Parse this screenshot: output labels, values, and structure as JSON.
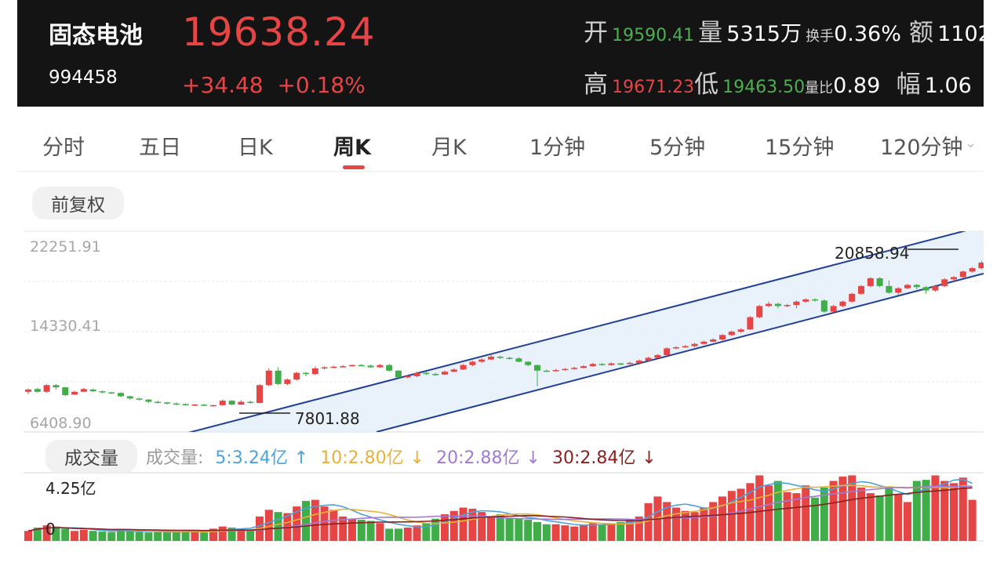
{
  "header": {
    "name": "固态电池",
    "code": "994458",
    "price": "19638.24",
    "change": "+34.48",
    "change_pct": "+0.18%",
    "open_label": "开",
    "open": "19590.41",
    "volume_label": "量",
    "volume": "5315万",
    "turnover_label": "换手",
    "turnover": "0.36%",
    "amount_label": "额",
    "amount": "1102",
    "high_label": "高",
    "high": "19671.23",
    "low_label": "低",
    "low": "19463.50",
    "vol_ratio_label": "量比",
    "vol_ratio": "0.89",
    "amplitude_label": "幅",
    "amplitude": "1.06"
  },
  "tabs": [
    {
      "label": "分时"
    },
    {
      "label": "五日"
    },
    {
      "label": "日K"
    },
    {
      "label": "周K",
      "active": true
    },
    {
      "label": "月K"
    },
    {
      "label": "1分钟"
    },
    {
      "label": "5分钟"
    },
    {
      "label": "15分钟"
    },
    {
      "label": "120分钟"
    }
  ],
  "adjust_label": "前复权",
  "volume_panel": {
    "label": "成交量",
    "ma_label": "成交量:",
    "ma5": "5:3.24亿",
    "ma10": "10:2.80亿",
    "ma20": "20:2.88亿",
    "ma30": "30:2.84亿",
    "max_label": "4.25亿",
    "zero_label": "0"
  },
  "chart_data": {
    "type": "candlestick",
    "y_axis_labels": [
      "22251.91",
      "14330.41",
      "6408.90"
    ],
    "ylim": [
      6408.9,
      22251.91
    ],
    "annotations": {
      "low": "7801.88",
      "high": "20858.94"
    },
    "colors": {
      "up": "#e54545",
      "down": "#3fae49",
      "channel": "#1f3f9a",
      "ma5": "#4aa3df",
      "ma10": "#e8b23a",
      "ma20": "#a27ad6",
      "ma30": "#8b2020"
    },
    "candles": [
      [
        9100,
        9300,
        9400,
        8900
      ],
      [
        9350,
        9100,
        9450,
        9000
      ],
      [
        9100,
        9700,
        9800,
        9000
      ],
      [
        9700,
        9500,
        9800,
        9300
      ],
      [
        9500,
        8800,
        9550,
        8700
      ],
      [
        8850,
        9100,
        9200,
        8800
      ],
      [
        9100,
        9350,
        9450,
        9050
      ],
      [
        9300,
        9150,
        9400,
        9100
      ],
      [
        9150,
        9050,
        9200,
        8950
      ],
      [
        9050,
        9000,
        9100,
        8900
      ],
      [
        9000,
        8700,
        9050,
        8600
      ],
      [
        8700,
        8500,
        8750,
        8400
      ],
      [
        8500,
        8400,
        8550,
        8300
      ],
      [
        8400,
        8200,
        8450,
        8100
      ],
      [
        8200,
        8150,
        8300,
        8050
      ],
      [
        8150,
        8050,
        8200,
        7950
      ],
      [
        8050,
        8000,
        8150,
        7900
      ],
      [
        8000,
        7900,
        8050,
        7850
      ],
      [
        7900,
        7950,
        8000,
        7800
      ],
      [
        7950,
        7850,
        8000,
        7800
      ],
      [
        7850,
        7900,
        7950,
        7802
      ],
      [
        7900,
        8300,
        8400,
        7850
      ],
      [
        8300,
        7950,
        8350,
        7900
      ],
      [
        7950,
        8200,
        8350,
        7900
      ],
      [
        8200,
        8100,
        8300,
        8050
      ],
      [
        8100,
        9700,
        9800,
        8050
      ],
      [
        9700,
        11000,
        11200,
        9600
      ],
      [
        11000,
        9800,
        11300,
        9700
      ],
      [
        9800,
        10200,
        10300,
        9700
      ],
      [
        10200,
        10800,
        10900,
        10100
      ],
      [
        10800,
        10700,
        10900,
        10500
      ],
      [
        10700,
        11200,
        11400,
        10600
      ],
      [
        11200,
        11300,
        11400,
        11100
      ],
      [
        11300,
        11350,
        11450,
        11250
      ],
      [
        11350,
        11400,
        11500,
        11300
      ],
      [
        11400,
        11500,
        11550,
        11350
      ],
      [
        11500,
        11450,
        11600,
        11400
      ],
      [
        11450,
        11300,
        11550,
        11250
      ],
      [
        11300,
        11500,
        11600,
        11250
      ],
      [
        11500,
        11000,
        11600,
        10900
      ],
      [
        11000,
        10400,
        11050,
        10300
      ],
      [
        10400,
        10500,
        10600,
        10300
      ],
      [
        10500,
        10800,
        10900,
        10400
      ],
      [
        10800,
        10700,
        10900,
        10600
      ],
      [
        10700,
        10650,
        10800,
        10550
      ],
      [
        10650,
        10900,
        11000,
        10600
      ],
      [
        10900,
        11100,
        11200,
        10850
      ],
      [
        11100,
        11500,
        11600,
        11050
      ],
      [
        11500,
        11800,
        11900,
        11400
      ],
      [
        11800,
        12000,
        12100,
        11700
      ],
      [
        12000,
        12250,
        12500,
        11950
      ],
      [
        12250,
        12150,
        12350,
        12050
      ],
      [
        12150,
        12100,
        12250,
        12000
      ],
      [
        12100,
        11800,
        12200,
        11750
      ],
      [
        11800,
        11500,
        11850,
        11400
      ],
      [
        11500,
        11000,
        11550,
        9600
      ],
      [
        11000,
        10950,
        11100,
        10900
      ],
      [
        10950,
        11050,
        11150,
        10900
      ],
      [
        11050,
        11150,
        11250,
        11000
      ],
      [
        11150,
        11250,
        11350,
        11100
      ],
      [
        11250,
        11400,
        11500,
        11200
      ],
      [
        11400,
        11600,
        11700,
        11350
      ],
      [
        11600,
        11500,
        11700,
        11450
      ],
      [
        11500,
        11650,
        11750,
        11450
      ],
      [
        11650,
        11600,
        11700,
        11500
      ],
      [
        11600,
        11700,
        11800,
        11550
      ],
      [
        11700,
        11900,
        12000,
        11650
      ],
      [
        11900,
        12150,
        12250,
        11850
      ],
      [
        12150,
        12400,
        12500,
        12100
      ],
      [
        12400,
        13000,
        13100,
        12350
      ],
      [
        13000,
        13100,
        13200,
        12950
      ],
      [
        13100,
        13200,
        13300,
        13050
      ],
      [
        13200,
        13400,
        13500,
        13100
      ],
      [
        13400,
        13600,
        13700,
        13350
      ],
      [
        13600,
        13800,
        13900,
        13550
      ],
      [
        13800,
        14200,
        14300,
        13700
      ],
      [
        14200,
        14500,
        14600,
        14100
      ],
      [
        14500,
        14700,
        14800,
        14400
      ],
      [
        14700,
        15800,
        15900,
        14650
      ],
      [
        15800,
        16800,
        16900,
        15700
      ],
      [
        16800,
        17000,
        17200,
        16700
      ],
      [
        17000,
        16800,
        17100,
        16600
      ],
      [
        16800,
        16900,
        17000,
        16700
      ],
      [
        16900,
        17200,
        17300,
        16600
      ],
      [
        17200,
        17400,
        17500,
        17100
      ],
      [
        17400,
        17300,
        17500,
        17200
      ],
      [
        17300,
        16300,
        17400,
        16200
      ],
      [
        16300,
        16800,
        16900,
        16200
      ],
      [
        16800,
        17200,
        17300,
        16700
      ],
      [
        17200,
        17900,
        18000,
        17100
      ],
      [
        17900,
        18600,
        18700,
        17800
      ],
      [
        18600,
        19300,
        19400,
        18500
      ],
      [
        19300,
        18600,
        19400,
        18500
      ],
      [
        18600,
        18000,
        19100,
        17900
      ],
      [
        18000,
        18400,
        18500,
        17800
      ],
      [
        18400,
        18700,
        18800,
        18300
      ],
      [
        18700,
        18500,
        18800,
        18300
      ],
      [
        18500,
        18200,
        18600,
        17900
      ],
      [
        18200,
        18600,
        18700,
        18100
      ],
      [
        18600,
        19200,
        19300,
        18500
      ],
      [
        19200,
        19400,
        19500,
        19000
      ],
      [
        19400,
        19900,
        20000,
        19300
      ],
      [
        19900,
        20200,
        20300,
        19800
      ],
      [
        20200,
        20700,
        20859,
        20100
      ],
      [
        20700,
        19800,
        20800,
        19400
      ],
      [
        19590,
        19638,
        19671,
        19463
      ]
    ],
    "volumes": [
      0.45,
      0.6,
      0.7,
      0.65,
      0.55,
      0.45,
      0.5,
      0.45,
      0.42,
      0.4,
      0.5,
      0.45,
      0.4,
      0.38,
      0.4,
      0.4,
      0.42,
      0.45,
      0.4,
      0.38,
      0.55,
      0.65,
      0.6,
      0.55,
      0.5,
      1.1,
      1.4,
      1.3,
      1.25,
      1.55,
      1.8,
      1.85,
      1.55,
      1.4,
      1.1,
      1.0,
      0.95,
      0.9,
      0.8,
      0.55,
      0.55,
      0.6,
      0.7,
      0.8,
      1.0,
      1.2,
      1.35,
      1.5,
      1.45,
      1.3,
      1.1,
      1.2,
      1.05,
      1.0,
      0.95,
      0.85,
      0.75,
      0.75,
      0.7,
      0.65,
      0.7,
      0.8,
      0.75,
      0.8,
      0.85,
      0.95,
      1.1,
      1.7,
      2.0,
      1.75,
      1.5,
      1.35,
      1.3,
      1.5,
      1.75,
      2.0,
      2.25,
      2.35,
      2.6,
      2.95,
      2.5,
      2.7,
      2.2,
      2.15,
      2.5,
      1.95,
      2.4,
      2.7,
      2.9,
      2.95,
      2.4,
      2.15,
      2.05,
      2.4,
      2.1,
      1.75,
      2.7,
      2.75,
      2.95,
      2.7,
      2.6,
      2.85,
      1.85
    ]
  }
}
